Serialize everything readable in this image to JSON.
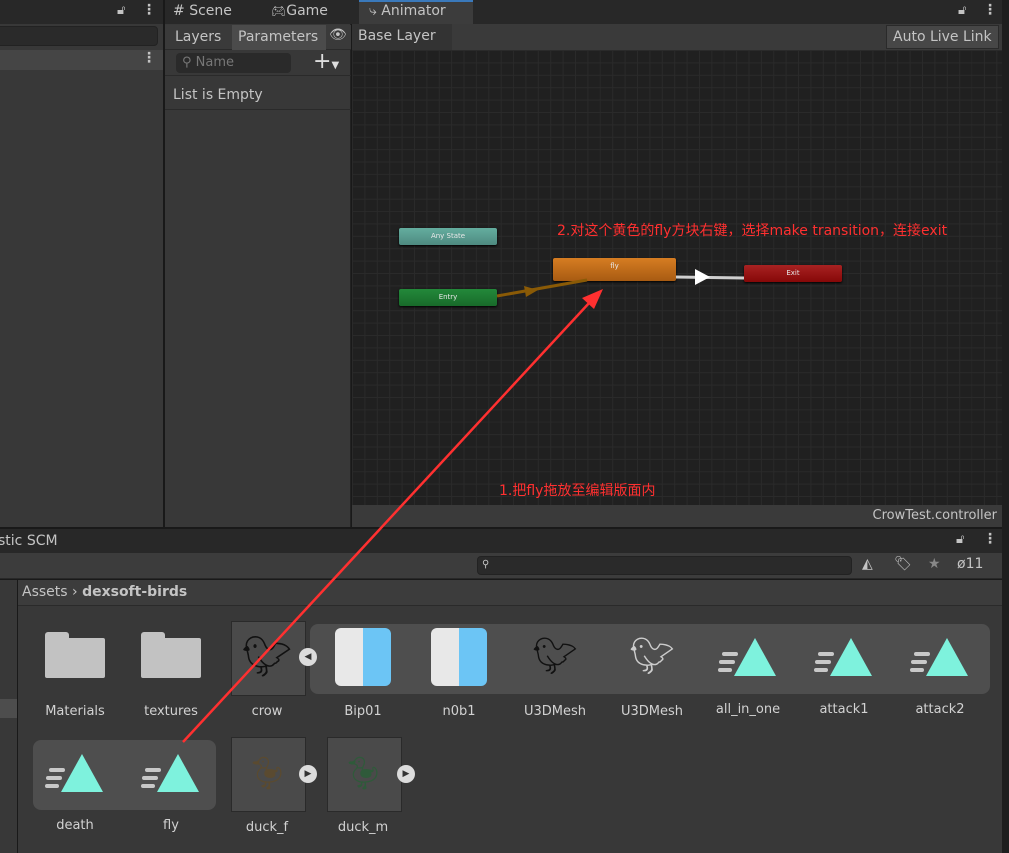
{
  "left_panel": {
    "menu_icons": [
      "lock-icon",
      "kebab-icon"
    ]
  },
  "tabs": [
    {
      "label": "Scene",
      "icon": "grid-icon"
    },
    {
      "label": "Game",
      "icon": "gamepad-icon"
    },
    {
      "label": "Animator",
      "icon": "animator-icon",
      "active": true
    }
  ],
  "animator": {
    "subtabs": [
      "Layers",
      "Parameters"
    ],
    "active_subtab": "Parameters",
    "breadcrumb": "Base Layer",
    "auto_live_link": "Auto Live Link",
    "search_placeholder": "Name",
    "list_empty": "List is Empty",
    "footer": "CrowTest.controller",
    "nodes": {
      "any_state": "Any State",
      "entry": "Entry",
      "fly": "fly",
      "exit": "Exit"
    },
    "colors": {
      "any_state": "#5aa39a",
      "entry": "#1d7a30",
      "fly": "#d0781e",
      "exit": "#9a1212"
    }
  },
  "annotations": {
    "step2": "2.对这个黄色的fly方块右键，选择make transition，连接exit",
    "step1": "1.把fly拖放至编辑版面内",
    "color": "#ff3030"
  },
  "project": {
    "title": "stic SCM",
    "hidden_count": "11",
    "breadcrumb": {
      "root": "Assets",
      "current": "dexsoft-birds"
    },
    "assets": [
      "Materials",
      "textures",
      "crow",
      "Bip01",
      "n0b1",
      "U3DMesh",
      "U3DMesh",
      "all_in_one",
      "attack1",
      "attack2",
      "death",
      "fly",
      "duck_f",
      "duck_m"
    ]
  }
}
